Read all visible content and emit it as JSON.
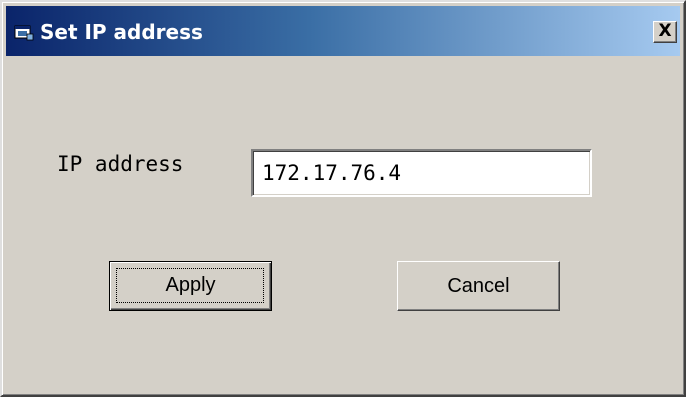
{
  "window": {
    "title": "Set IP address",
    "close_glyph": "X",
    "title_icon": "app-window-icon"
  },
  "form": {
    "ip_label": "IP address",
    "ip_value": "172.17.76.4"
  },
  "buttons": {
    "apply_label": "Apply",
    "cancel_label": "Cancel"
  },
  "colors": {
    "title_start": "#0a246a",
    "title_end": "#a6caf0",
    "face": "#d4d0c8"
  }
}
